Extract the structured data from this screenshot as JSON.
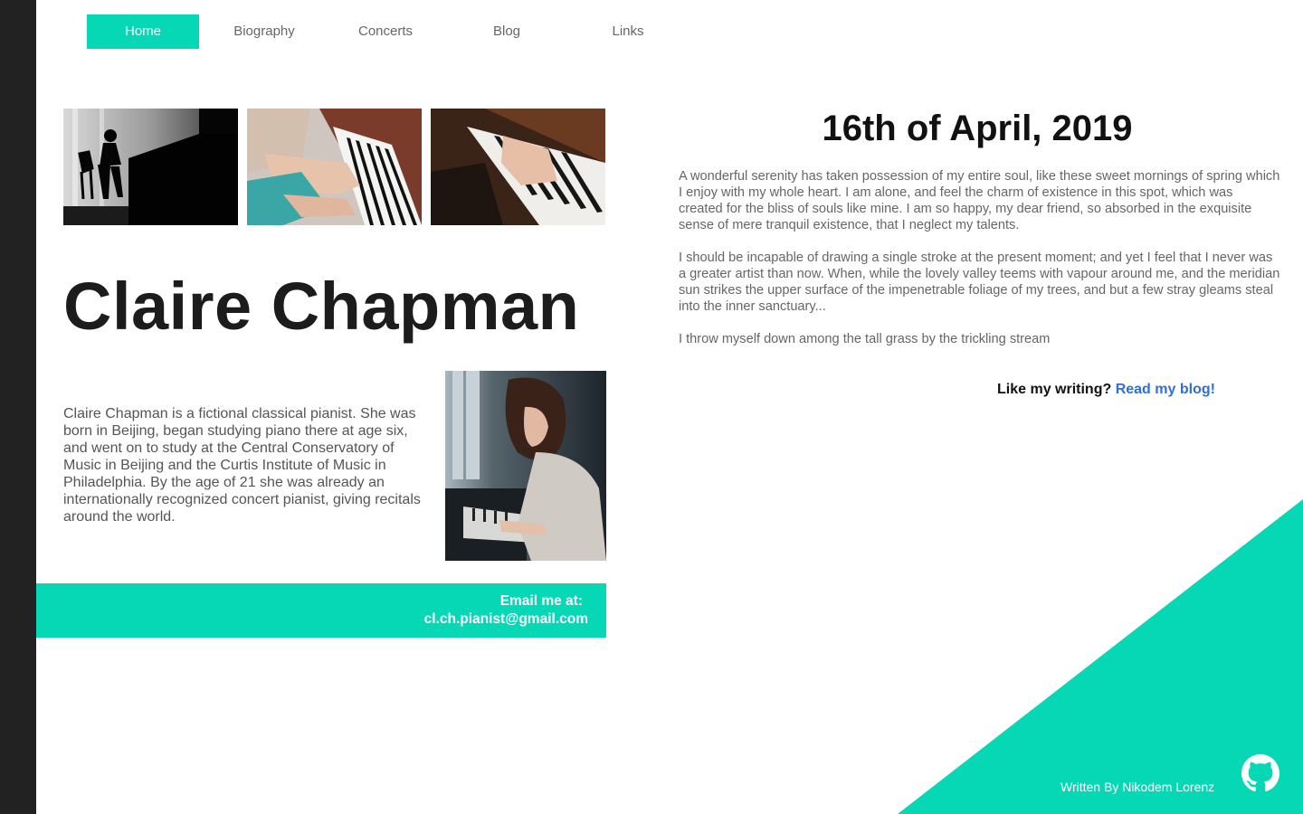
{
  "nav": {
    "items": [
      {
        "label": "Home",
        "active": true
      },
      {
        "label": "Biography",
        "active": false
      },
      {
        "label": "Concerts",
        "active": false
      },
      {
        "label": "Blog",
        "active": false
      },
      {
        "label": "Links",
        "active": false
      }
    ]
  },
  "gallery": {
    "images": [
      "pianist-silhouette-photo",
      "hands-on-piano-keys-photo",
      "upright-piano-keys-photo"
    ]
  },
  "profile": {
    "name": "Claire Chapman",
    "bio": "Claire Chapman is a fictional classical pianist. She was born in Beijing, began studying piano there at age six, and went on to study at the Central Conservatory of Music in Beijing and the Curtis Institute of Music in Philadelphia. By the age of 21 she was already an internationally recognized concert pianist, giving recitals around the world.",
    "portrait": "woman-playing-piano-photo"
  },
  "contact": {
    "label": "Email me at:",
    "email": "cl.ch.pianist@gmail.com"
  },
  "post": {
    "date": "16th of April, 2019",
    "paragraphs": [
      "A wonderful serenity has taken possession of my entire soul, like these sweet mornings of spring which I enjoy with my whole heart. I am alone, and feel the charm of existence in this spot, which was created for the bliss of souls like mine. I am so happy, my dear friend, so absorbed in the exquisite sense of mere tranquil existence, that I neglect my talents.",
      "I should be incapable of drawing a single stroke at the present moment; and yet I feel that I never was a greater artist than now. When, while the lovely valley teems with vapour around me, and the meridian sun strikes the upper surface of the impenetrable foliage of my trees, and but a few stray gleams steal into the inner sanctuary...",
      "I throw myself down among the tall grass by the trickling stream"
    ]
  },
  "blog_cta": {
    "text": "Like my writing?",
    "link": "Read my blog!"
  },
  "footer": {
    "credit": "Written By Nikodem Lorenz",
    "icon": "github-icon"
  },
  "colors": {
    "accent": "#06d8b6",
    "link": "#2f6de1",
    "sidebar": "#222222"
  }
}
